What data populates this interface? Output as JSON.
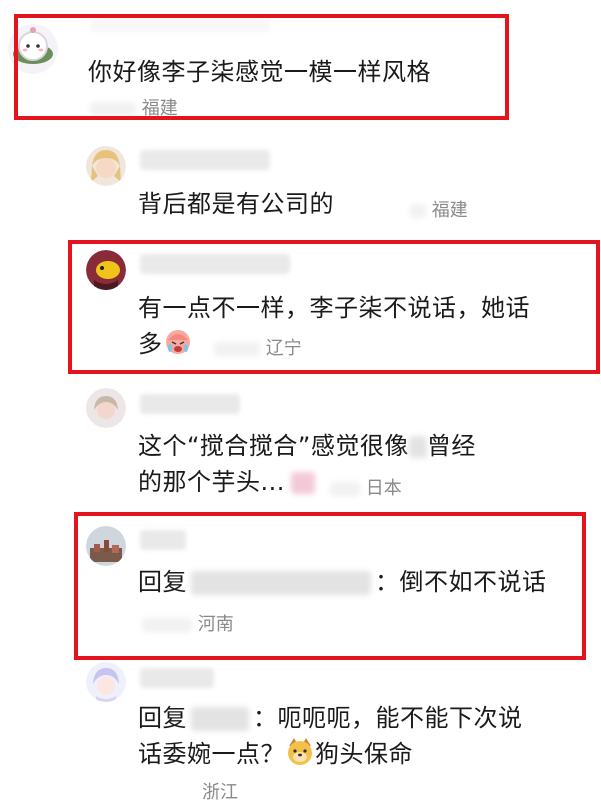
{
  "comments": [
    {
      "id": "c1",
      "text": "你好像李子柒感觉一模一样风格",
      "location": "福建"
    },
    {
      "id": "c2",
      "text": "背后都是有公司的",
      "location": "福建"
    },
    {
      "id": "c3",
      "line1": "有一点不一样，李子柒不说话，她话",
      "line2": "多",
      "location": "辽宁"
    },
    {
      "id": "c4",
      "line1a": "这个“搅合搅合”感觉很像",
      "line1b": "曾经",
      "line2": "的那个芋头...",
      "location": "日本"
    },
    {
      "id": "c5",
      "prefix": "回复",
      "text": "：倒不如不说话",
      "location": "河南"
    },
    {
      "id": "c6",
      "prefix": "回复",
      "line1": "：呃呃呃，能不能下次说",
      "line2": "话委婉一点？",
      "line2b": "狗头保命",
      "location": "浙江"
    }
  ],
  "colors": {
    "highlight": "#e3141e",
    "meta": "#8a8a8a",
    "text": "#1a1a1a"
  }
}
